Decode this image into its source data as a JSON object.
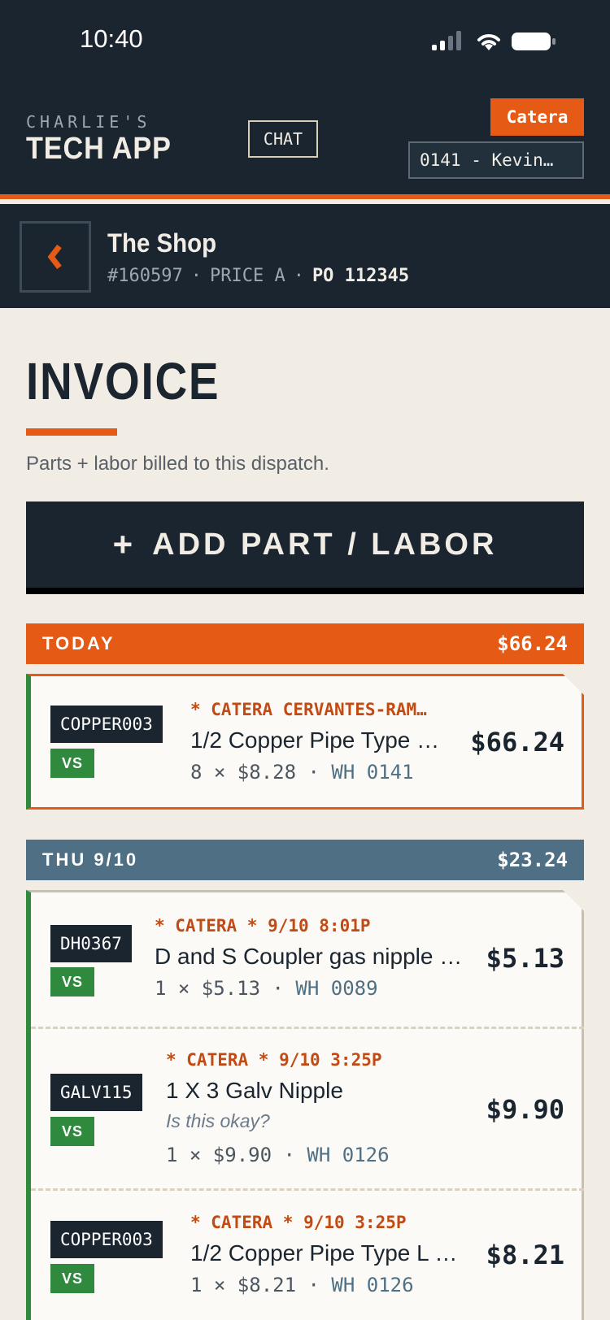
{
  "status_bar": {
    "time": "10:40"
  },
  "header": {
    "brand_top": "CHARLIE'S",
    "brand_main": "TECH APP",
    "chat_label": "CHAT",
    "tenant": "Catera",
    "tech_selector": "0141 - Kevin…"
  },
  "job": {
    "title": "The Shop",
    "number": "#160597",
    "price_level": "PRICE A",
    "po": "PO 112345"
  },
  "invoice": {
    "title": "INVOICE",
    "subtitle": "Parts + labor billed to this dispatch.",
    "add_label": "ADD PART / LABOR",
    "add_icon": "+"
  },
  "days": [
    {
      "label": "TODAY",
      "total": "$66.24",
      "items": [
        {
          "sku": "COPPER003",
          "badge": "VS",
          "who": "* CATERA CERVANTES-RAM…",
          "name": "1/2 Copper Pipe Type …",
          "qty": "8 × $8.28",
          "wh": "WH 0141",
          "price": "$66.24"
        }
      ]
    },
    {
      "label": "THU 9/10",
      "total": "$23.24",
      "items": [
        {
          "sku": "DH0367",
          "badge": "VS",
          "who": "* CATERA * 9/10 8:01P",
          "name": "D and S Coupler gas nipple …",
          "qty": "1 × $5.13",
          "wh": "WH 0089",
          "price": "$5.13"
        },
        {
          "sku": "GALV115",
          "badge": "VS",
          "who": "* CATERA * 9/10 3:25P",
          "name": "1 X 3 Galv Nipple",
          "note": "Is this okay?",
          "qty": "1 × $9.90",
          "wh": "WH 0126",
          "price": "$9.90"
        },
        {
          "sku": "COPPER003",
          "badge": "VS",
          "who": "* CATERA * 9/10 3:25P",
          "name": "1/2 Copper Pipe Type L …",
          "qty": "1 × $8.21",
          "wh": "WH 0126",
          "price": "$8.21"
        }
      ]
    }
  ],
  "colors": {
    "navy": "#1b2530",
    "accent": "#e55a14",
    "slate": "#4f6f84",
    "green": "#2f8a3e",
    "paper": "#f1ede5"
  },
  "icons": [
    "cellular-signal-icon",
    "wifi-icon",
    "battery-icon",
    "chevron-left-icon",
    "plus-icon"
  ]
}
